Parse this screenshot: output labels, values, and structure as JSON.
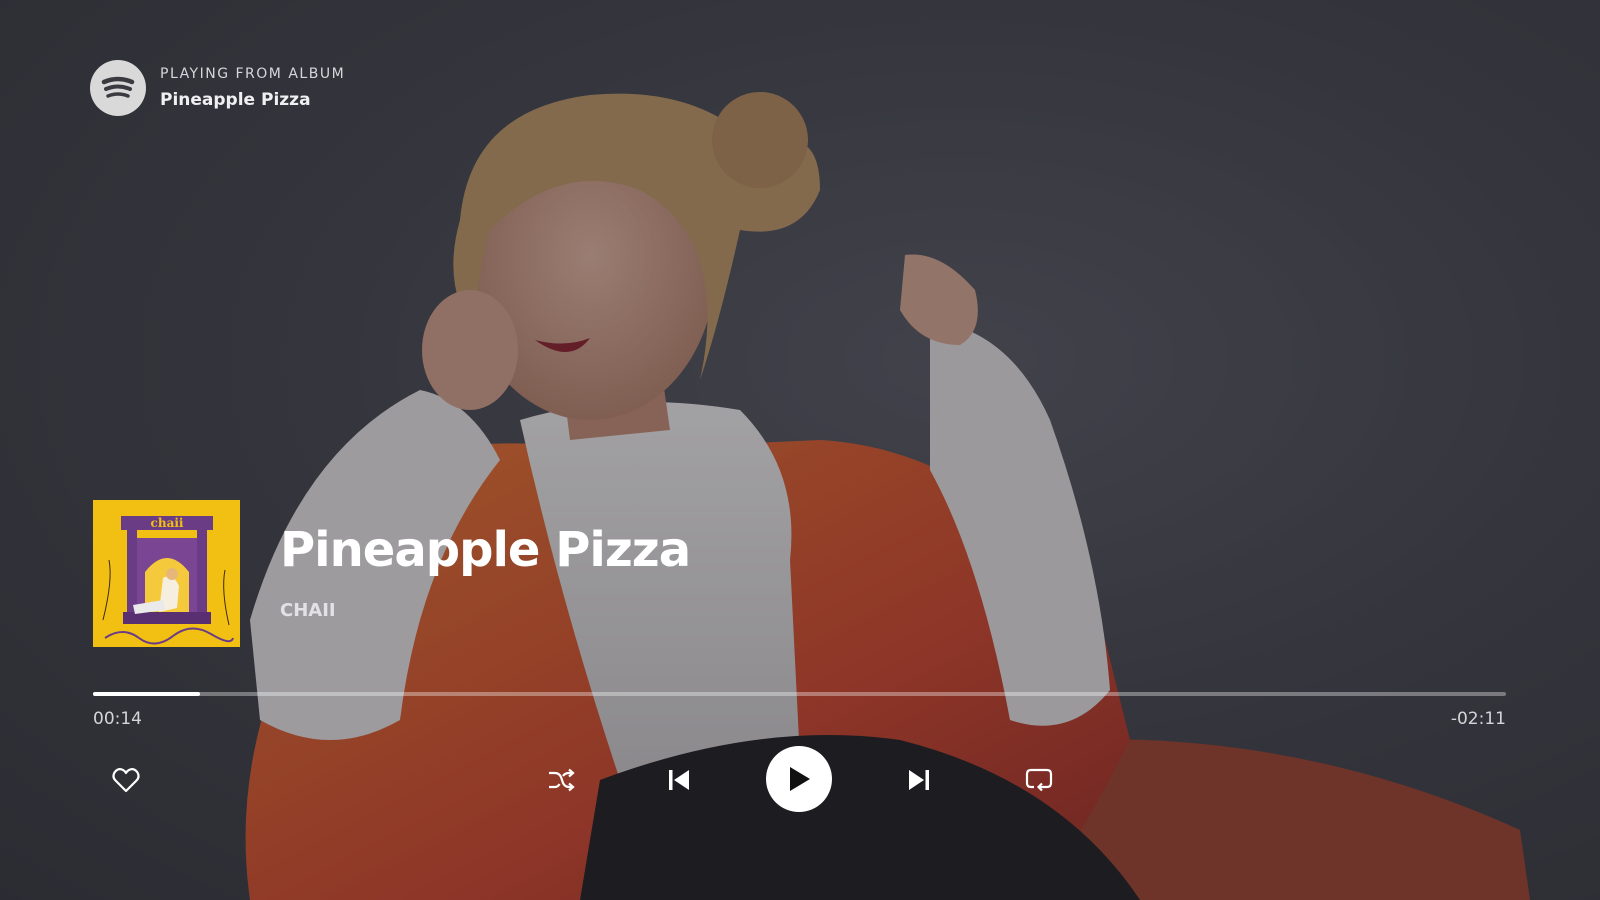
{
  "header": {
    "context_label": "PLAYING FROM ALBUM",
    "context_name": "Pineapple Pizza",
    "logo_icon": "spotify-logo-icon"
  },
  "track": {
    "title": "Pineapple Pizza",
    "artist": "CHAII",
    "album_art_text": "chaii"
  },
  "progress": {
    "elapsed": "00:14",
    "remaining": "-02:11",
    "fraction": 0.076
  },
  "controls": {
    "like_icon": "heart-outline-icon",
    "shuffle_icon": "shuffle-icon",
    "previous_icon": "skip-previous-icon",
    "play_icon": "play-icon",
    "next_icon": "skip-next-icon",
    "repeat_icon": "repeat-icon"
  },
  "colors": {
    "album_yellow": "#f2c012",
    "album_purple": "#6b3c86",
    "jacket_orange": "#d9542a"
  }
}
